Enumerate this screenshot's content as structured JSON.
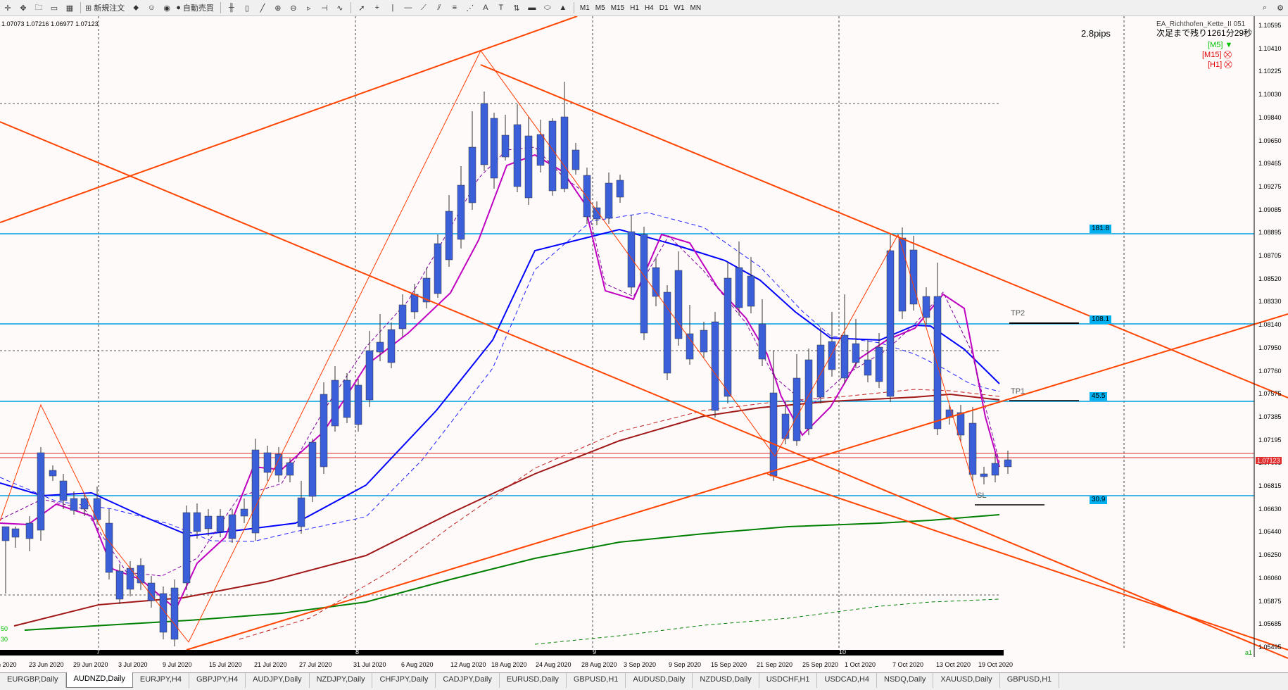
{
  "toolbar": {
    "new_order": "新規注文",
    "auto_trade": "自動売買",
    "timeframes": [
      "M1",
      "M5",
      "M15",
      "H1",
      "H4",
      "D1",
      "W1",
      "MN"
    ]
  },
  "chart": {
    "ohlc_readout": "1.07073 1.07216 1.06977 1.07123",
    "spread": "2.8pips",
    "ea_name": "EA_Richthofen_Kette_II 051",
    "ea_countdown": "次足まで残り1261分29秒",
    "tf_signals": [
      {
        "label": "[M5]",
        "color": "#00c000"
      },
      {
        "label": "[M15]",
        "color": "#e00000"
      },
      {
        "label": "[H1]",
        "color": "#e00000"
      }
    ],
    "current_price": "1.07123",
    "price_axis": [
      "1.10595",
      "1.10410",
      "1.10225",
      "1.10030",
      "1.09840",
      "1.09650",
      "1.09465",
      "1.09275",
      "1.09085",
      "1.08895",
      "1.08705",
      "1.08520",
      "1.08330",
      "1.08140",
      "1.07950",
      "1.07760",
      "1.07575",
      "1.07385",
      "1.07195",
      "1.07005",
      "1.06815",
      "1.06630",
      "1.06440",
      "1.06250",
      "1.06060",
      "1.05875",
      "1.05685",
      "1.05495"
    ],
    "date_axis": [
      "n 2020",
      "23 Jun 2020",
      "29 Jun 2020",
      "3 Jul 2020",
      "9 Jul 2020",
      "15 Jul 2020",
      "21 Jul 2020",
      "27 Jul 2020",
      "31 Jul 2020",
      "6 Aug 2020",
      "12 Aug 2020",
      "18 Aug 2020",
      "24 Aug 2020",
      "28 Aug 2020",
      "3 Sep 2020",
      "9 Sep 2020",
      "15 Sep 2020",
      "21 Sep 2020",
      "25 Sep 2020",
      "1 Oct 2020",
      "7 Oct 2020",
      "13 Oct 2020",
      "19 Oct 2020"
    ],
    "separators": [
      "7",
      "8",
      "9",
      "10"
    ],
    "fib_levels": [
      "181.8",
      "108.1",
      "45.5",
      "30.9"
    ],
    "targets": {
      "tp2": "TP2",
      "tp1": "TP1",
      "sl": "SL"
    },
    "left_labels": [
      "50",
      "30"
    ],
    "bottom_right": "a1"
  },
  "symbol_tabs": [
    "EURGBP,Daily",
    "AUDNZD,Daily",
    "EURJPY,H4",
    "GBPJPY,H4",
    "AUDJPY,Daily",
    "NZDJPY,Daily",
    "CHFJPY,Daily",
    "CADJPY,Daily",
    "EURUSD,Daily",
    "GBPUSD,H1",
    "AUDUSD,Daily",
    "NZDUSD,Daily",
    "USDCHF,H1",
    "USDCAD,H4",
    "NSDQ,Daily",
    "XAUUSD,Daily",
    "GBPUSD,H1"
  ],
  "active_tab_index": 1
}
